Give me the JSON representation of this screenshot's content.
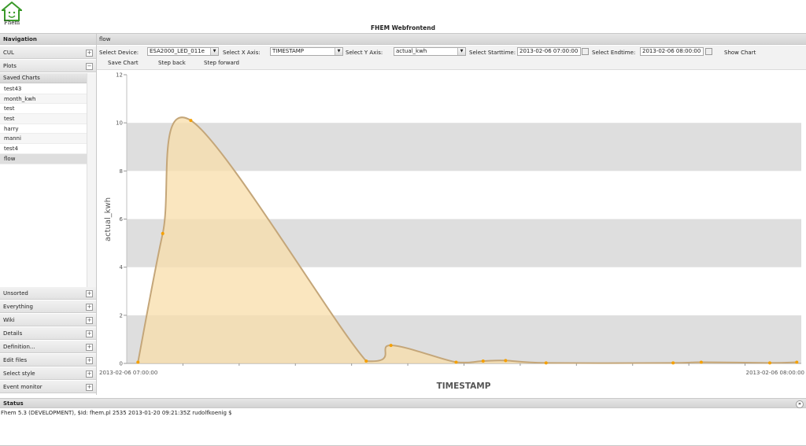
{
  "app": {
    "logo_text": "Fhem",
    "title": "FHEM Webfrontend"
  },
  "sidebar": {
    "header": "Navigation",
    "sections_top": [
      {
        "label": "CUL",
        "toggle": "+"
      },
      {
        "label": "Plots",
        "toggle": "−"
      }
    ],
    "saved_charts_header": "Saved Charts",
    "saved_charts": [
      "test43",
      "month_kwh",
      "test",
      "test",
      "harry",
      "manni",
      "test4",
      "flow"
    ],
    "sections_bottom": [
      {
        "label": "Unsorted",
        "toggle": "+"
      },
      {
        "label": "Everything",
        "toggle": "+"
      },
      {
        "label": "Wiki",
        "toggle": "+"
      },
      {
        "label": "Details",
        "toggle": "+"
      },
      {
        "label": "Definition...",
        "toggle": "+"
      },
      {
        "label": "Edit files",
        "toggle": "+"
      },
      {
        "label": "Select style",
        "toggle": "+"
      },
      {
        "label": "Event monitor",
        "toggle": "+"
      }
    ]
  },
  "main": {
    "header": "flow",
    "toolbar": {
      "device_label": "Select Device:",
      "device_value": "ESA2000_LED_011e",
      "xaxis_label": "Select X Axis:",
      "xaxis_value": "TIMESTAMP",
      "yaxis_label": "Select Y Axis:",
      "yaxis_value": "actual_kwh",
      "start_label": "Select Starttime:",
      "start_value": "2013-02-06 07:00:00",
      "end_label": "Select Endtime:",
      "end_value": "2013-02-06 08:00:00",
      "show_chart": "Show Chart",
      "save_chart": "Save Chart",
      "step_back": "Step back",
      "step_forward": "Step forward"
    }
  },
  "chart_data": {
    "type": "area",
    "xlabel": "TIMESTAMP",
    "ylabel": "actual_kwh",
    "x_start_label": "2013-02-06 07:00:00",
    "x_end_label": "2013-02-06 08:00:00",
    "y_ticks": [
      "0",
      "2",
      "4",
      "6",
      "8",
      "10",
      "12"
    ],
    "ylim": [
      0,
      12
    ],
    "xlim_minutes": [
      0,
      60
    ],
    "grid": "alternating horizontal bands",
    "fill_color": "#f8ddaa",
    "line_color": "#c4a679",
    "point_color": "#f5a000",
    "points": [
      {
        "x": 1,
        "y": 0.05
      },
      {
        "x": 3.2,
        "y": 5.4
      },
      {
        "x": 5.7,
        "y": 10.1
      },
      {
        "x": 21.3,
        "y": 0.1
      },
      {
        "x": 23.5,
        "y": 0.75
      },
      {
        "x": 29.3,
        "y": 0.05
      },
      {
        "x": 31.7,
        "y": 0.1
      },
      {
        "x": 33.7,
        "y": 0.12
      },
      {
        "x": 37.3,
        "y": 0.02
      },
      {
        "x": 48.6,
        "y": 0.02
      },
      {
        "x": 51.1,
        "y": 0.05
      },
      {
        "x": 57.2,
        "y": 0.02
      },
      {
        "x": 59.6,
        "y": 0.05
      }
    ]
  },
  "status": {
    "header": "Status",
    "text": "Fhem 5.3 (DEVELOPMENT), $Id: fhem.pl 2535 2013-01-20 09:21:35Z rudolfkoenig $"
  }
}
